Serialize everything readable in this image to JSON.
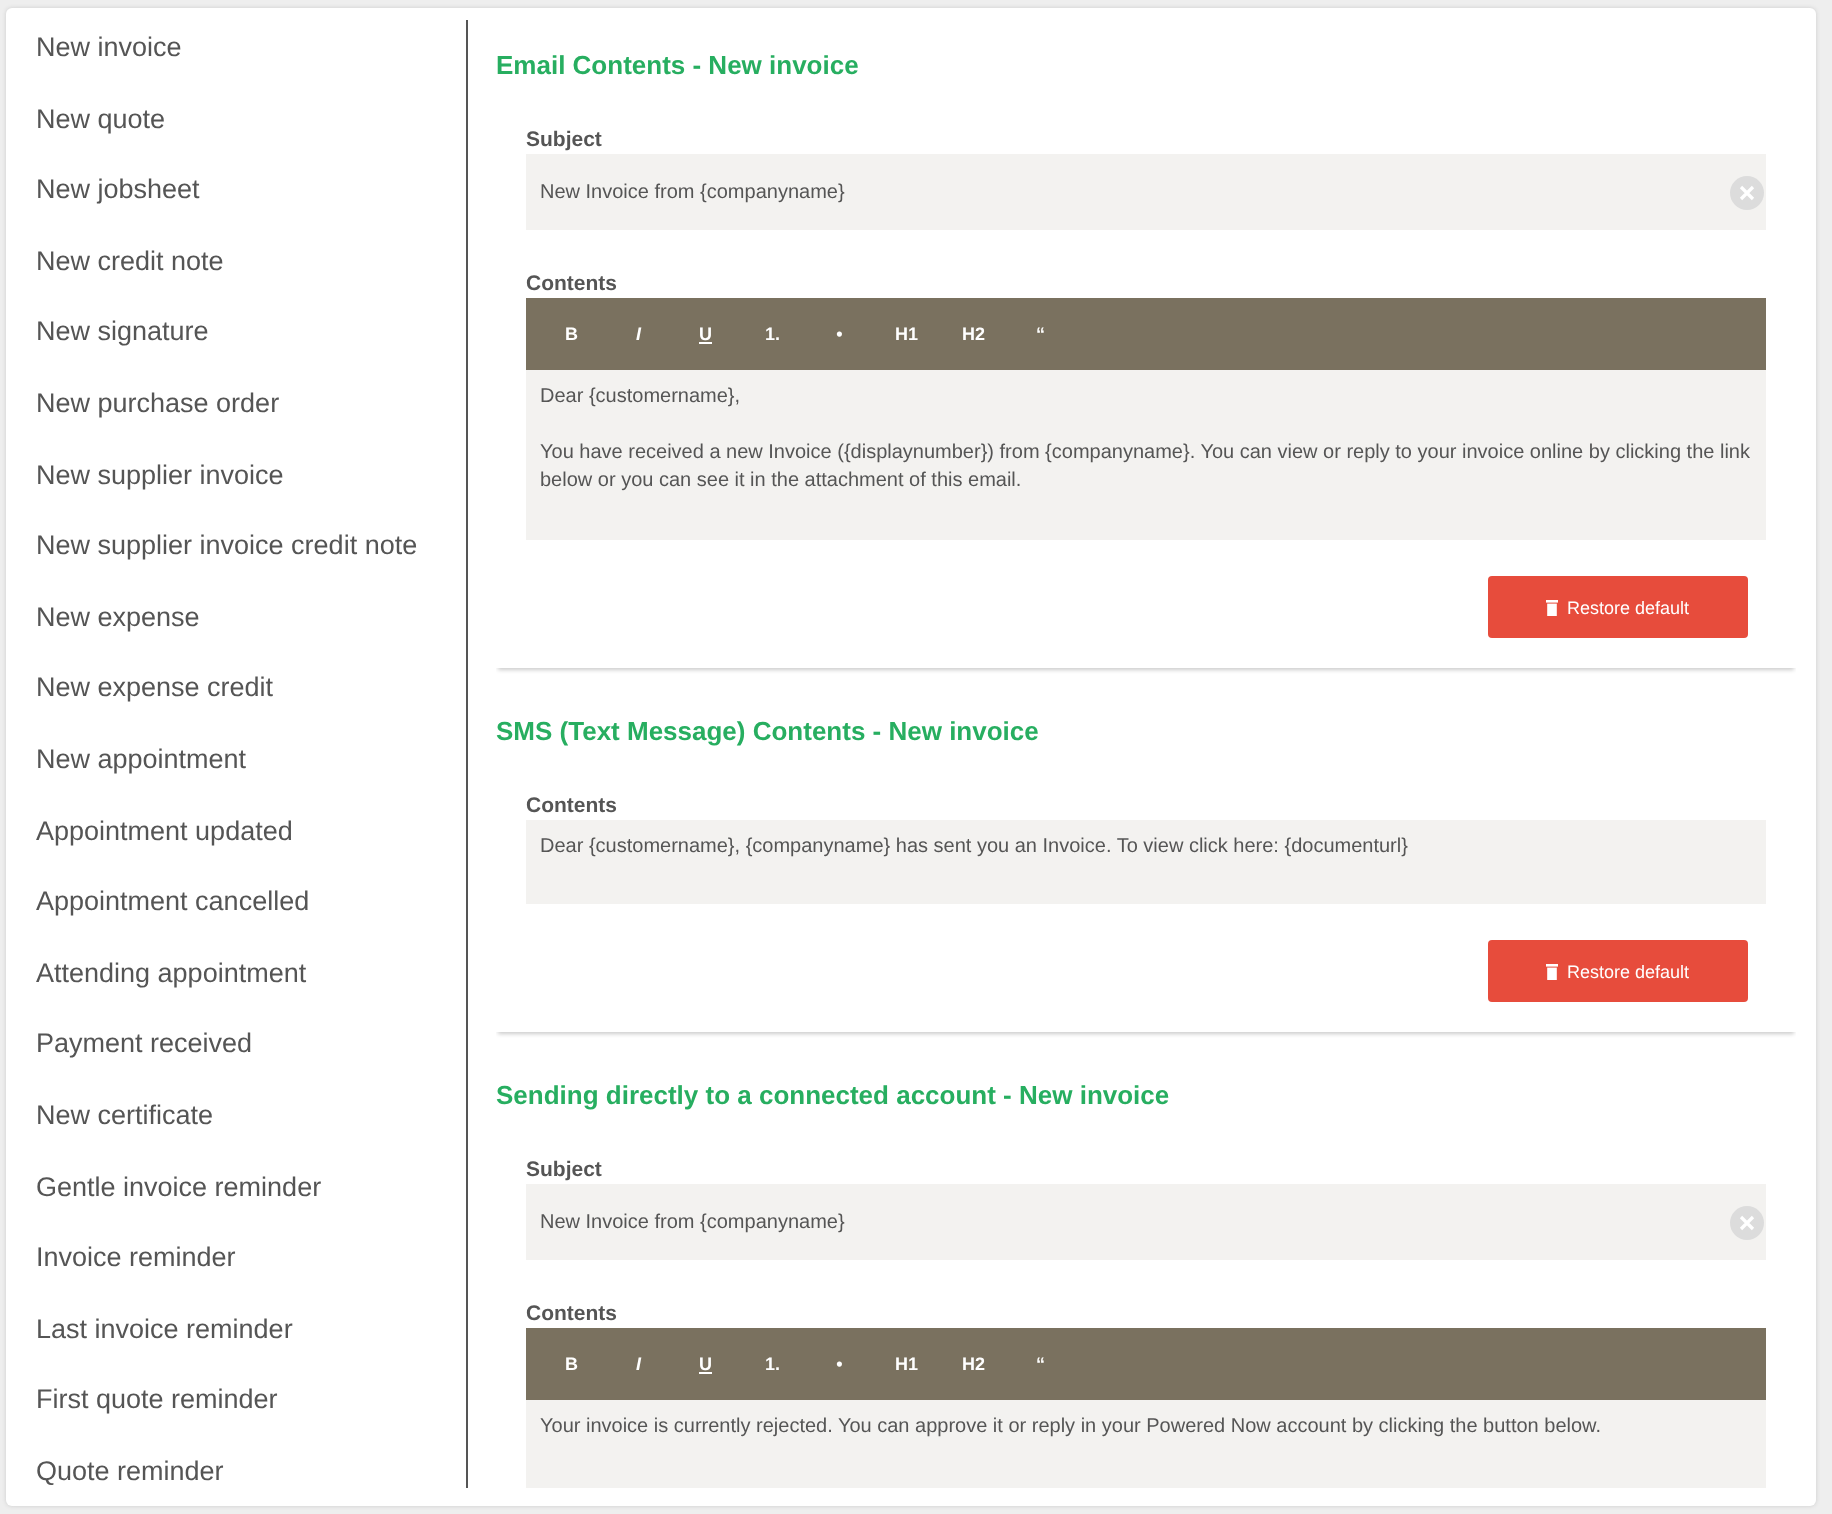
{
  "sidebar": {
    "items": [
      {
        "label": "New invoice",
        "selected": false
      },
      {
        "label": "New quote",
        "selected": false
      },
      {
        "label": "New jobsheet",
        "selected": false
      },
      {
        "label": "New credit note",
        "selected": false
      },
      {
        "label": "New signature",
        "selected": false
      },
      {
        "label": "New purchase order",
        "selected": false
      },
      {
        "label": "New supplier invoice",
        "selected": false
      },
      {
        "label": "New supplier invoice credit note",
        "selected": false
      },
      {
        "label": "New expense",
        "selected": false
      },
      {
        "label": "New expense credit",
        "selected": false
      },
      {
        "label": "New appointment",
        "selected": false
      },
      {
        "label": "Appointment updated",
        "selected": false
      },
      {
        "label": "Appointment cancelled",
        "selected": false
      },
      {
        "label": "Attending appointment",
        "selected": false
      },
      {
        "label": "Payment received",
        "selected": false
      },
      {
        "label": "New certificate",
        "selected": false
      },
      {
        "label": "Gentle invoice reminder",
        "selected": false
      },
      {
        "label": "Invoice reminder",
        "selected": false
      },
      {
        "label": "Last invoice reminder",
        "selected": false
      },
      {
        "label": "First quote reminder",
        "selected": false
      },
      {
        "label": "Quote reminder",
        "selected": false
      }
    ]
  },
  "sections": [
    {
      "title": "Email Contents - New invoice",
      "fields": [
        {
          "kind": "input",
          "label": "Subject",
          "value": "New Invoice from {companyname}"
        },
        {
          "kind": "editor",
          "label": "Contents",
          "toolbar": [
            "B",
            "I",
            "U",
            "1.",
            "•",
            "H1",
            "H2",
            "“"
          ],
          "paragraphs": [
            "Dear {customername},",
            "You have received a new Invoice ({displaynumber}) from {companyname}. You can view or reply to your invoice online by clicking the link below or you can see it in the attachment of this email."
          ]
        }
      ],
      "button": "Restore default"
    },
    {
      "title": "SMS (Text Message) Contents - New invoice",
      "fields": [
        {
          "kind": "textarea",
          "label": "Contents",
          "paragraphs": [
            "Dear {customername}, {companyname} has sent you an Invoice. To view click here: {documenturl}"
          ]
        }
      ],
      "button": "Restore default"
    },
    {
      "title": "Sending directly to a connected account - New invoice",
      "fields": [
        {
          "kind": "input",
          "label": "Subject",
          "value": "New Invoice from {companyname}"
        },
        {
          "kind": "editor",
          "label": "Contents",
          "toolbar": [
            "B",
            "I",
            "U",
            "1.",
            "•",
            "H1",
            "H2",
            "“"
          ],
          "paragraphs": [
            "Your invoice is currently rejected. You can approve it or reply in your Powered Now account by clicking the button below."
          ]
        }
      ]
    }
  ]
}
